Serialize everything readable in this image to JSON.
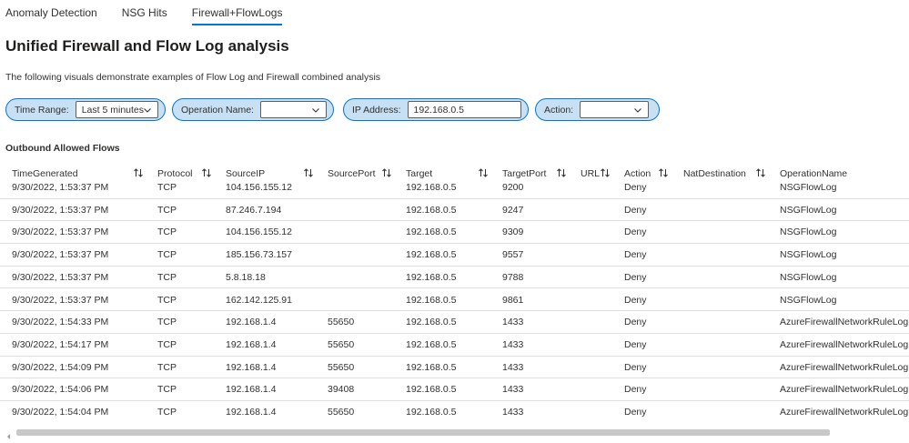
{
  "tabs": [
    {
      "label": "Anomaly Detection",
      "active": false
    },
    {
      "label": "NSG Hits",
      "active": false
    },
    {
      "label": "Firewall+FlowLogs",
      "active": true
    }
  ],
  "title": "Unified Firewall and Flow Log analysis",
  "description": "The following visuals demonstrate examples of Flow Log and Firewall combined analysis",
  "filters": {
    "time_range": {
      "label": "Time Range:",
      "value": "Last 5 minutes"
    },
    "operation_name": {
      "label": "Operation Name:",
      "value": ""
    },
    "ip_address": {
      "label": "IP Address:",
      "value": "192.168.0.5"
    },
    "action": {
      "label": "Action:",
      "value": ""
    }
  },
  "section_title": "Outbound Allowed Flows",
  "table": {
    "columns": [
      "TimeGenerated",
      "Protocol",
      "SourceIP",
      "SourcePort",
      "Target",
      "TargetPort",
      "URL",
      "Action",
      "NatDestination",
      "OperationName"
    ],
    "rows": [
      [
        "9/30/2022, 1:53:37 PM",
        "TCP",
        "104.156.155.12",
        "",
        "192.168.0.5",
        "9200",
        "",
        "Deny",
        "",
        "NSGFlowLog"
      ],
      [
        "9/30/2022, 1:53:37 PM",
        "TCP",
        "87.246.7.194",
        "",
        "192.168.0.5",
        "9247",
        "",
        "Deny",
        "",
        "NSGFlowLog"
      ],
      [
        "9/30/2022, 1:53:37 PM",
        "TCP",
        "104.156.155.12",
        "",
        "192.168.0.5",
        "9309",
        "",
        "Deny",
        "",
        "NSGFlowLog"
      ],
      [
        "9/30/2022, 1:53:37 PM",
        "TCP",
        "185.156.73.157",
        "",
        "192.168.0.5",
        "9557",
        "",
        "Deny",
        "",
        "NSGFlowLog"
      ],
      [
        "9/30/2022, 1:53:37 PM",
        "TCP",
        "5.8.18.18",
        "",
        "192.168.0.5",
        "9788",
        "",
        "Deny",
        "",
        "NSGFlowLog"
      ],
      [
        "9/30/2022, 1:53:37 PM",
        "TCP",
        "162.142.125.91",
        "",
        "192.168.0.5",
        "9861",
        "",
        "Deny",
        "",
        "NSGFlowLog"
      ],
      [
        "9/30/2022, 1:54:33 PM",
        "TCP",
        "192.168.1.4",
        "55650",
        "192.168.0.5",
        "1433",
        "",
        "Deny",
        "",
        "AzureFirewallNetworkRuleLog"
      ],
      [
        "9/30/2022, 1:54:17 PM",
        "TCP",
        "192.168.1.4",
        "55650",
        "192.168.0.5",
        "1433",
        "",
        "Deny",
        "",
        "AzureFirewallNetworkRuleLog"
      ],
      [
        "9/30/2022, 1:54:09 PM",
        "TCP",
        "192.168.1.4",
        "55650",
        "192.168.0.5",
        "1433",
        "",
        "Deny",
        "",
        "AzureFirewallNetworkRuleLog"
      ],
      [
        "9/30/2022, 1:54:06 PM",
        "TCP",
        "192.168.1.4",
        "39408",
        "192.168.0.5",
        "1433",
        "",
        "Deny",
        "",
        "AzureFirewallNetworkRuleLog"
      ],
      [
        "9/30/2022, 1:54:04 PM",
        "TCP",
        "192.168.1.4",
        "55650",
        "192.168.0.5",
        "1433",
        "",
        "Deny",
        "",
        "AzureFirewallNetworkRuleLog"
      ]
    ]
  },
  "icons": {
    "dropdown": "chevron-down-icon",
    "sort": "sort-arrows-icon",
    "scroll_left": "chevron-left-icon"
  },
  "colors": {
    "accent": "#0078d4",
    "pill_background": "#c7e0f4",
    "row_divider": "#e1dfdd"
  }
}
